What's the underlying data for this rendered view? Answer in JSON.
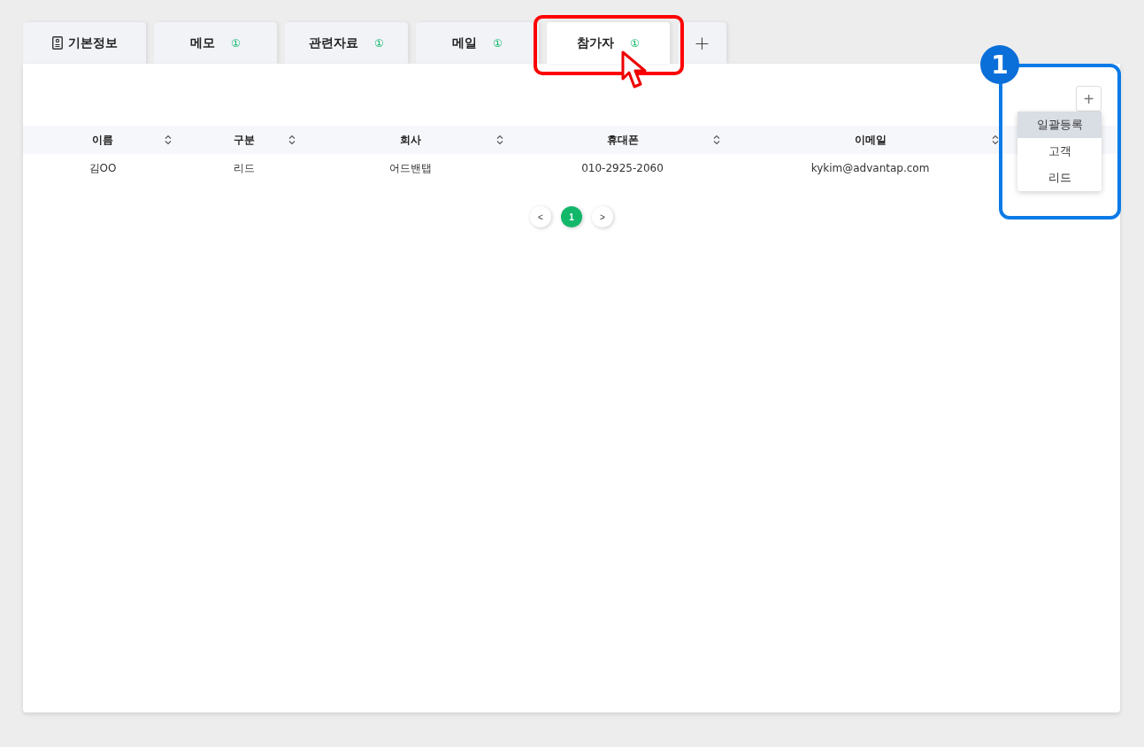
{
  "tabs": [
    {
      "kind": "info",
      "label": "기본정보",
      "selected": false
    },
    {
      "kind": "count",
      "label": "메모",
      "count": "①",
      "selected": false
    },
    {
      "kind": "count",
      "label": "관련자료",
      "count": "①",
      "selected": false
    },
    {
      "kind": "count",
      "label": "메일",
      "count": "①",
      "selected": false
    },
    {
      "kind": "count",
      "label": "참가자",
      "count": "①",
      "selected": true
    },
    {
      "kind": "add",
      "label": "+",
      "selected": false
    }
  ],
  "add_menu": {
    "button": "+",
    "items": [
      {
        "label": "일괄등록",
        "selected": true
      },
      {
        "label": "고객",
        "selected": false
      },
      {
        "label": "리드",
        "selected": false
      }
    ]
  },
  "table": {
    "columns": [
      "이름",
      "구분",
      "회사",
      "휴대폰",
      "이메일"
    ],
    "rows": [
      [
        "김OO",
        "리드",
        "어드밴탭",
        "010-2925-2060",
        "kykim@advantap.com"
      ]
    ]
  },
  "pagination": {
    "prev": "<",
    "pages": [
      {
        "label": "1",
        "selected": true
      }
    ],
    "next": ">"
  },
  "annotation": {
    "badge": "1"
  }
}
